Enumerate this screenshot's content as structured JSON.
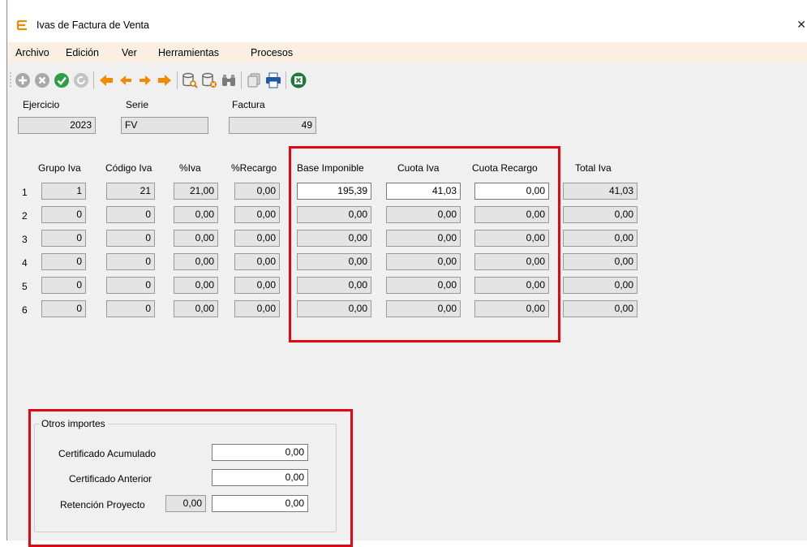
{
  "window": {
    "title": "Ivas de Factura de Venta",
    "close_glyph": "✕"
  },
  "menu": [
    "Archivo",
    "Edición",
    "Ver",
    "Herramientas",
    "Procesos"
  ],
  "toolbar": {
    "icons": [
      "add-icon",
      "cancel-icon",
      "confirm-icon",
      "refresh-icon",
      "first-record-icon",
      "previous-record-icon",
      "next-record-icon",
      "last-record-icon",
      "search-database-icon",
      "delete-database-icon",
      "find-binoculars-icon",
      "copy-icon",
      "print-icon",
      "excel-export-icon"
    ]
  },
  "header": {
    "ejercicio_label": "Ejercicio",
    "ejercicio_value": "2023",
    "serie_label": "Serie",
    "serie_value": "FV",
    "factura_label": "Factura",
    "factura_value": "49"
  },
  "table": {
    "columns": [
      "Grupo Iva",
      "Código Iva",
      "%Iva",
      "%Recargo",
      "Base Imponible",
      "Cuota Iva",
      "Cuota Recargo",
      "Total Iva"
    ],
    "rows": [
      {
        "n": "1",
        "grupo": "1",
        "codigo": "21",
        "iva": "21,00",
        "recargo": "0,00",
        "base": "195,39",
        "cuota_iva": "41,03",
        "cuota_recargo": "0,00",
        "total": "41,03"
      },
      {
        "n": "2",
        "grupo": "0",
        "codigo": "0",
        "iva": "0,00",
        "recargo": "0,00",
        "base": "0,00",
        "cuota_iva": "0,00",
        "cuota_recargo": "0,00",
        "total": "0,00"
      },
      {
        "n": "3",
        "grupo": "0",
        "codigo": "0",
        "iva": "0,00",
        "recargo": "0,00",
        "base": "0,00",
        "cuota_iva": "0,00",
        "cuota_recargo": "0,00",
        "total": "0,00"
      },
      {
        "n": "4",
        "grupo": "0",
        "codigo": "0",
        "iva": "0,00",
        "recargo": "0,00",
        "base": "0,00",
        "cuota_iva": "0,00",
        "cuota_recargo": "0,00",
        "total": "0,00"
      },
      {
        "n": "5",
        "grupo": "0",
        "codigo": "0",
        "iva": "0,00",
        "recargo": "0,00",
        "base": "0,00",
        "cuota_iva": "0,00",
        "cuota_recargo": "0,00",
        "total": "0,00"
      },
      {
        "n": "6",
        "grupo": "0",
        "codigo": "0",
        "iva": "0,00",
        "recargo": "0,00",
        "base": "0,00",
        "cuota_iva": "0,00",
        "cuota_recargo": "0,00",
        "total": "0,00"
      }
    ]
  },
  "otros": {
    "legend": "Otros importes",
    "cert_acum_label": "Certificado Acumulado",
    "cert_acum_value": "0,00",
    "cert_ant_label": "Certificado Anterior",
    "cert_ant_value": "0,00",
    "retencion_label": "Retención Proyecto",
    "retencion_pct": "0,00",
    "retencion_value": "0,00"
  },
  "colors": {
    "highlight": "#e30613",
    "menubar": "#fbefe2",
    "app_accent": "#f08a00"
  }
}
